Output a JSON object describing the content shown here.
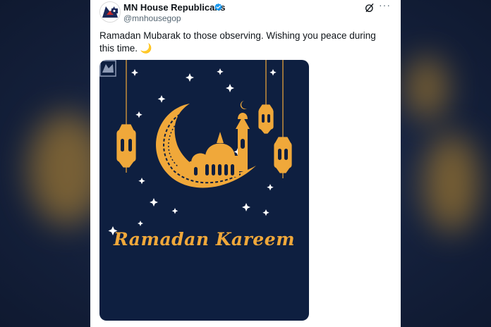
{
  "post": {
    "display_name": "MN House Republicans",
    "handle": "@mnhousegop",
    "text": "Ramadan Mubarak to those observing. Wishing you peace during this time. 🌙",
    "more_label": "···"
  },
  "media": {
    "heading": "Ramadan Kareem"
  },
  "colors": {
    "accent_gold": "#f0a83a",
    "media_bg": "#0e1f40",
    "verified_blue": "#1d9bf0"
  },
  "icons": [
    "verified-badge-icon",
    "grok-icon",
    "more-options-icon",
    "crescent-moon-icon",
    "mosque-icon",
    "lantern-icon",
    "star-icon",
    "watermark-logo-icon"
  ]
}
